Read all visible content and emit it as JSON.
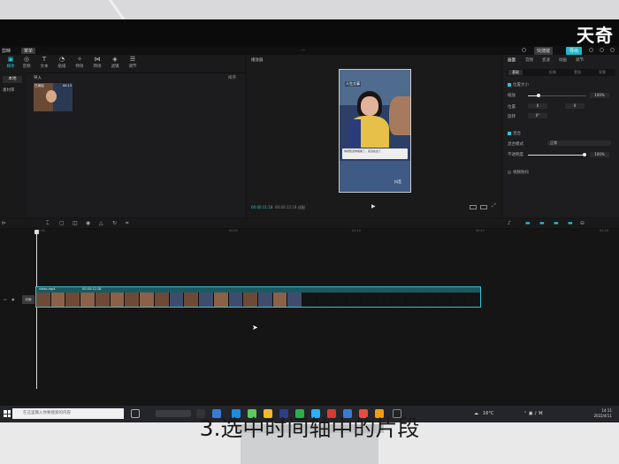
{
  "watermark": "天奇",
  "subtitle": "3.选中时间轴中的片段",
  "app": {
    "name": "剪映",
    "menu": "菜单",
    "shortcut": "快捷键",
    "export": "导出"
  },
  "media": {
    "tools": [
      "媒体",
      "音频",
      "文本",
      "贴纸",
      "特效",
      "转场",
      "滤镜",
      "调节"
    ],
    "sidebar": [
      "本地",
      "素材库"
    ],
    "import": "导入",
    "view": "排序",
    "thumb_label": "已添加",
    "thumb_duration": "00:13"
  },
  "player": {
    "title": "播放器",
    "caption": "人生大事",
    "sub_line1": "你就知道你爸爸了，就没在这了",
    "sub_line2": "",
    "tiktok": "抖音",
    "time_current": "00:00:11:18",
    "time_total": "00:00:12:18",
    "ratio": "适配"
  },
  "props": {
    "tabs": [
      "画面",
      "音频",
      "变速",
      "动画",
      "调节"
    ],
    "subtabs": [
      "基础",
      "抠像",
      "蒙版",
      "背景"
    ],
    "section1": "位置大小",
    "scale_label": "缩放",
    "scale_value": "100%",
    "position_label": "位置",
    "x_value": "0",
    "y_value": "0",
    "rotate_label": "旋转",
    "rotate_value": "0°",
    "section2": "混合",
    "blend_label": "混合模式",
    "blend_value": "正常",
    "opacity_label": "不透明度",
    "opacity_value": "100%",
    "section3": "视频防抖"
  },
  "timeline": {
    "ticks": [
      "00:00",
      "00:05",
      "00:10",
      "00:15",
      "00:20"
    ],
    "track_cover": "封面",
    "clip_name": "video.mp4",
    "clip_duration": "00:00:12:18"
  },
  "taskbar": {
    "search_placeholder": "在这里输入你要搜索的内容",
    "weather": "16°C",
    "time": "14:11",
    "date": "2022/4/11"
  }
}
